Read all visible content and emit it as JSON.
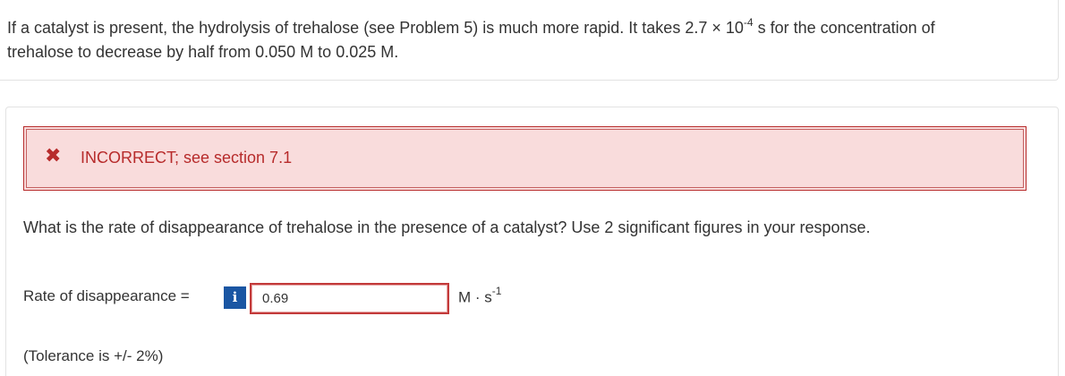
{
  "question": {
    "text_part1": "If a catalyst is present, the hydrolysis of trehalose (see Problem 5) is much more rapid. It takes 2.7 × 10",
    "exponent": "-4",
    "text_part2": " s for the concentration of",
    "text_line2": "trehalose to decrease by half from 0.050 M to 0.025 M."
  },
  "feedback": {
    "icon": "x-icon",
    "status": "INCORRECT; see section 7.1",
    "color": "#b72b2b",
    "background": "#f9dcdc"
  },
  "prompt": "What is the rate of disappearance of trehalose in the presence of a catalyst? Use 2 significant figures in your response.",
  "answer": {
    "label": "Rate of disappearance =",
    "info_icon": "i",
    "value": "0.69",
    "unit_base": "M · s",
    "unit_exponent": "-1"
  },
  "tolerance": "(Tolerance is +/- 2%)"
}
